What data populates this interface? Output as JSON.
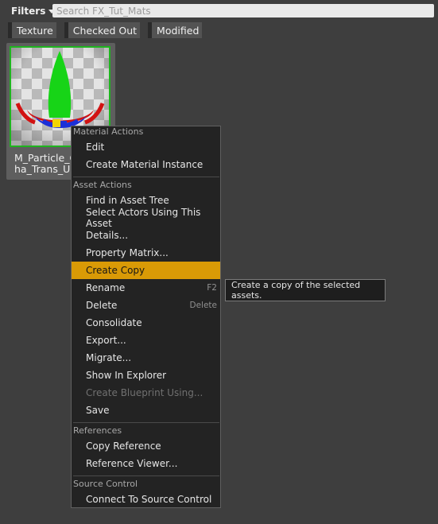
{
  "toolbar": {
    "filters_label": "Filters",
    "search_placeholder": "Search FX_Tut_Mats"
  },
  "filter_chips": [
    {
      "label": "Texture"
    },
    {
      "label": "Checked Out"
    },
    {
      "label": "Modified"
    }
  ],
  "asset": {
    "name": "M_Particle_C\nha_Trans_U",
    "border_color": "#1fb41f"
  },
  "context_menu": {
    "sections": [
      {
        "header": "Material Actions",
        "items": [
          "Edit",
          "Create Material Instance"
        ]
      },
      {
        "header": "Asset Actions",
        "items": [
          "Find in Asset Tree",
          "Select Actors Using This Asset",
          "Details...",
          "Property Matrix...",
          "Create Copy",
          "Rename",
          "Delete",
          "Consolidate",
          "Export...",
          "Migrate...",
          "Show In Explorer",
          "Create Blueprint Using...",
          "Save"
        ]
      },
      {
        "header": "References",
        "items": [
          "Copy Reference",
          "Reference Viewer..."
        ]
      },
      {
        "header": "Source Control",
        "items": [
          "Connect To Source Control"
        ]
      }
    ],
    "shortcuts": {
      "rename": "F2",
      "delete": "Delete"
    },
    "highlighted_item": "Create Copy",
    "disabled_item": "Create Blueprint Using...",
    "highlight_color": "#d99a06"
  },
  "tooltip": {
    "text": "Create a copy of the selected assets."
  }
}
